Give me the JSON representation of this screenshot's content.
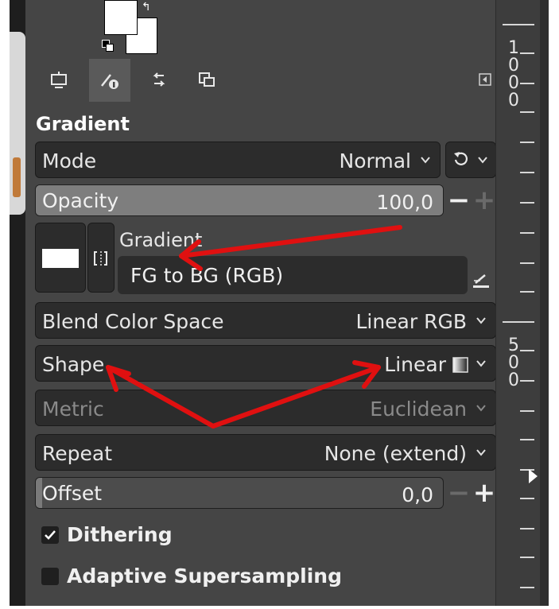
{
  "panel": {
    "title": "Gradient",
    "icons": {
      "tabs": [
        "device-status-icon",
        "tool-options-icon",
        "undo-history-icon",
        "images-icon"
      ],
      "menu": "panel-menu-icon"
    },
    "mode": {
      "label": "Mode",
      "value": "Normal"
    },
    "opacity": {
      "label": "Opacity",
      "value": "100,0",
      "fraction": 1.0,
      "minus": "−",
      "plus": "+"
    },
    "gradient": {
      "label": "Gradient",
      "name": "FG to BG (RGB)"
    },
    "blend_color_space": {
      "label": "Blend Color Space",
      "value": "Linear RGB"
    },
    "shape": {
      "label": "Shape",
      "value": "Linear"
    },
    "metric": {
      "label": "Metric",
      "value": "Euclidean"
    },
    "repeat": {
      "label": "Repeat",
      "value": "None (extend)"
    },
    "offset": {
      "label": "Offset",
      "value": "0,0",
      "fraction": 0.0,
      "minus": "−",
      "plus": "+"
    },
    "dithering": {
      "label": "Dithering",
      "checked": true
    },
    "adaptive_supersampling": {
      "label": "Adaptive Supersampling",
      "checked": false
    }
  },
  "ruler": {
    "labels": [
      {
        "text": "1\n0\n0\n0"
      },
      {
        "text": "5\n0\n0"
      }
    ]
  },
  "colors": {
    "panel_bg": "#454545",
    "field_bg": "#2c2c2c",
    "annotation_red": "#e01010"
  }
}
